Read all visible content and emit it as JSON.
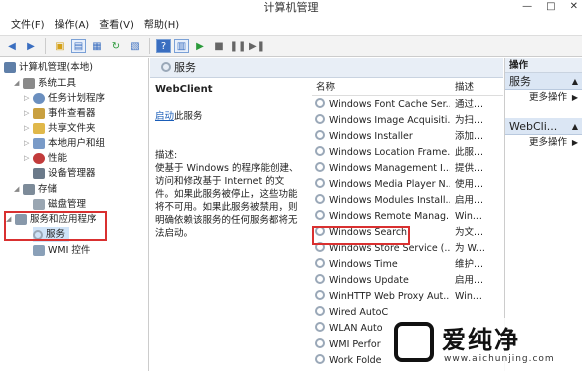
{
  "window": {
    "title": "计算机管理",
    "controls": [
      "—",
      "□",
      "✕"
    ]
  },
  "menu": [
    "文件(F)",
    "操作(A)",
    "查看(V)",
    "帮助(H)"
  ],
  "tree": {
    "root": "计算机管理(本地)",
    "system_tools": "系统工具",
    "task_scheduler": "任务计划程序",
    "event_viewer": "事件查看器",
    "shared_folders": "共享文件夹",
    "local_users": "本地用户和组",
    "performance": "性能",
    "device_manager": "设备管理器",
    "storage": "存储",
    "disk_management": "磁盘管理",
    "services_apps": "服务和应用程序",
    "services": "服务",
    "wmi": "WMI 控件"
  },
  "center": {
    "header": "服务",
    "selected_service": "WebClient",
    "start_link": "启动",
    "start_suffix": "此服务",
    "desc_label": "描述:",
    "desc_text": "使基于 Windows 的程序能创建、访问和修改基于 Internet 的文件。如果此服务被停止，这些功能将不可用。如果此服务被禁用，则明确依赖该服务的任何服务都将无法启动。",
    "col_name": "名称",
    "col_desc": "描述",
    "rows": [
      {
        "name": "Windows Font Cache Ser...",
        "desc": "通过..."
      },
      {
        "name": "Windows Image Acquisiti...",
        "desc": "为扫..."
      },
      {
        "name": "Windows Installer",
        "desc": "添加..."
      },
      {
        "name": "Windows Location Frame...",
        "desc": "此服..."
      },
      {
        "name": "Windows Management I...",
        "desc": "提供..."
      },
      {
        "name": "Windows Media Player N...",
        "desc": "使用..."
      },
      {
        "name": "Windows Modules Install...",
        "desc": "启用..."
      },
      {
        "name": "Windows Remote Manag...",
        "desc": "Win..."
      },
      {
        "name": "Windows Search",
        "desc": "为文..."
      },
      {
        "name": "Windows Store Service (...",
        "desc": "为 W..."
      },
      {
        "name": "Windows Time",
        "desc": "维护..."
      },
      {
        "name": "Windows Update",
        "desc": "启用..."
      },
      {
        "name": "WinHTTP Web Proxy Aut...",
        "desc": "Win..."
      },
      {
        "name": "Wired AutoC",
        "desc": ""
      },
      {
        "name": "WLAN Auto",
        "desc": ""
      },
      {
        "name": "WMI Perfor",
        "desc": ""
      },
      {
        "name": "Work Folde",
        "desc": ""
      }
    ]
  },
  "actions": {
    "header": "操作",
    "sec1": "服务",
    "more1": "更多操作",
    "sec2": "WebCli...",
    "more2": "更多操作"
  },
  "watermark": {
    "brand": "爱纯净",
    "url": "www.aichunjing.com"
  }
}
